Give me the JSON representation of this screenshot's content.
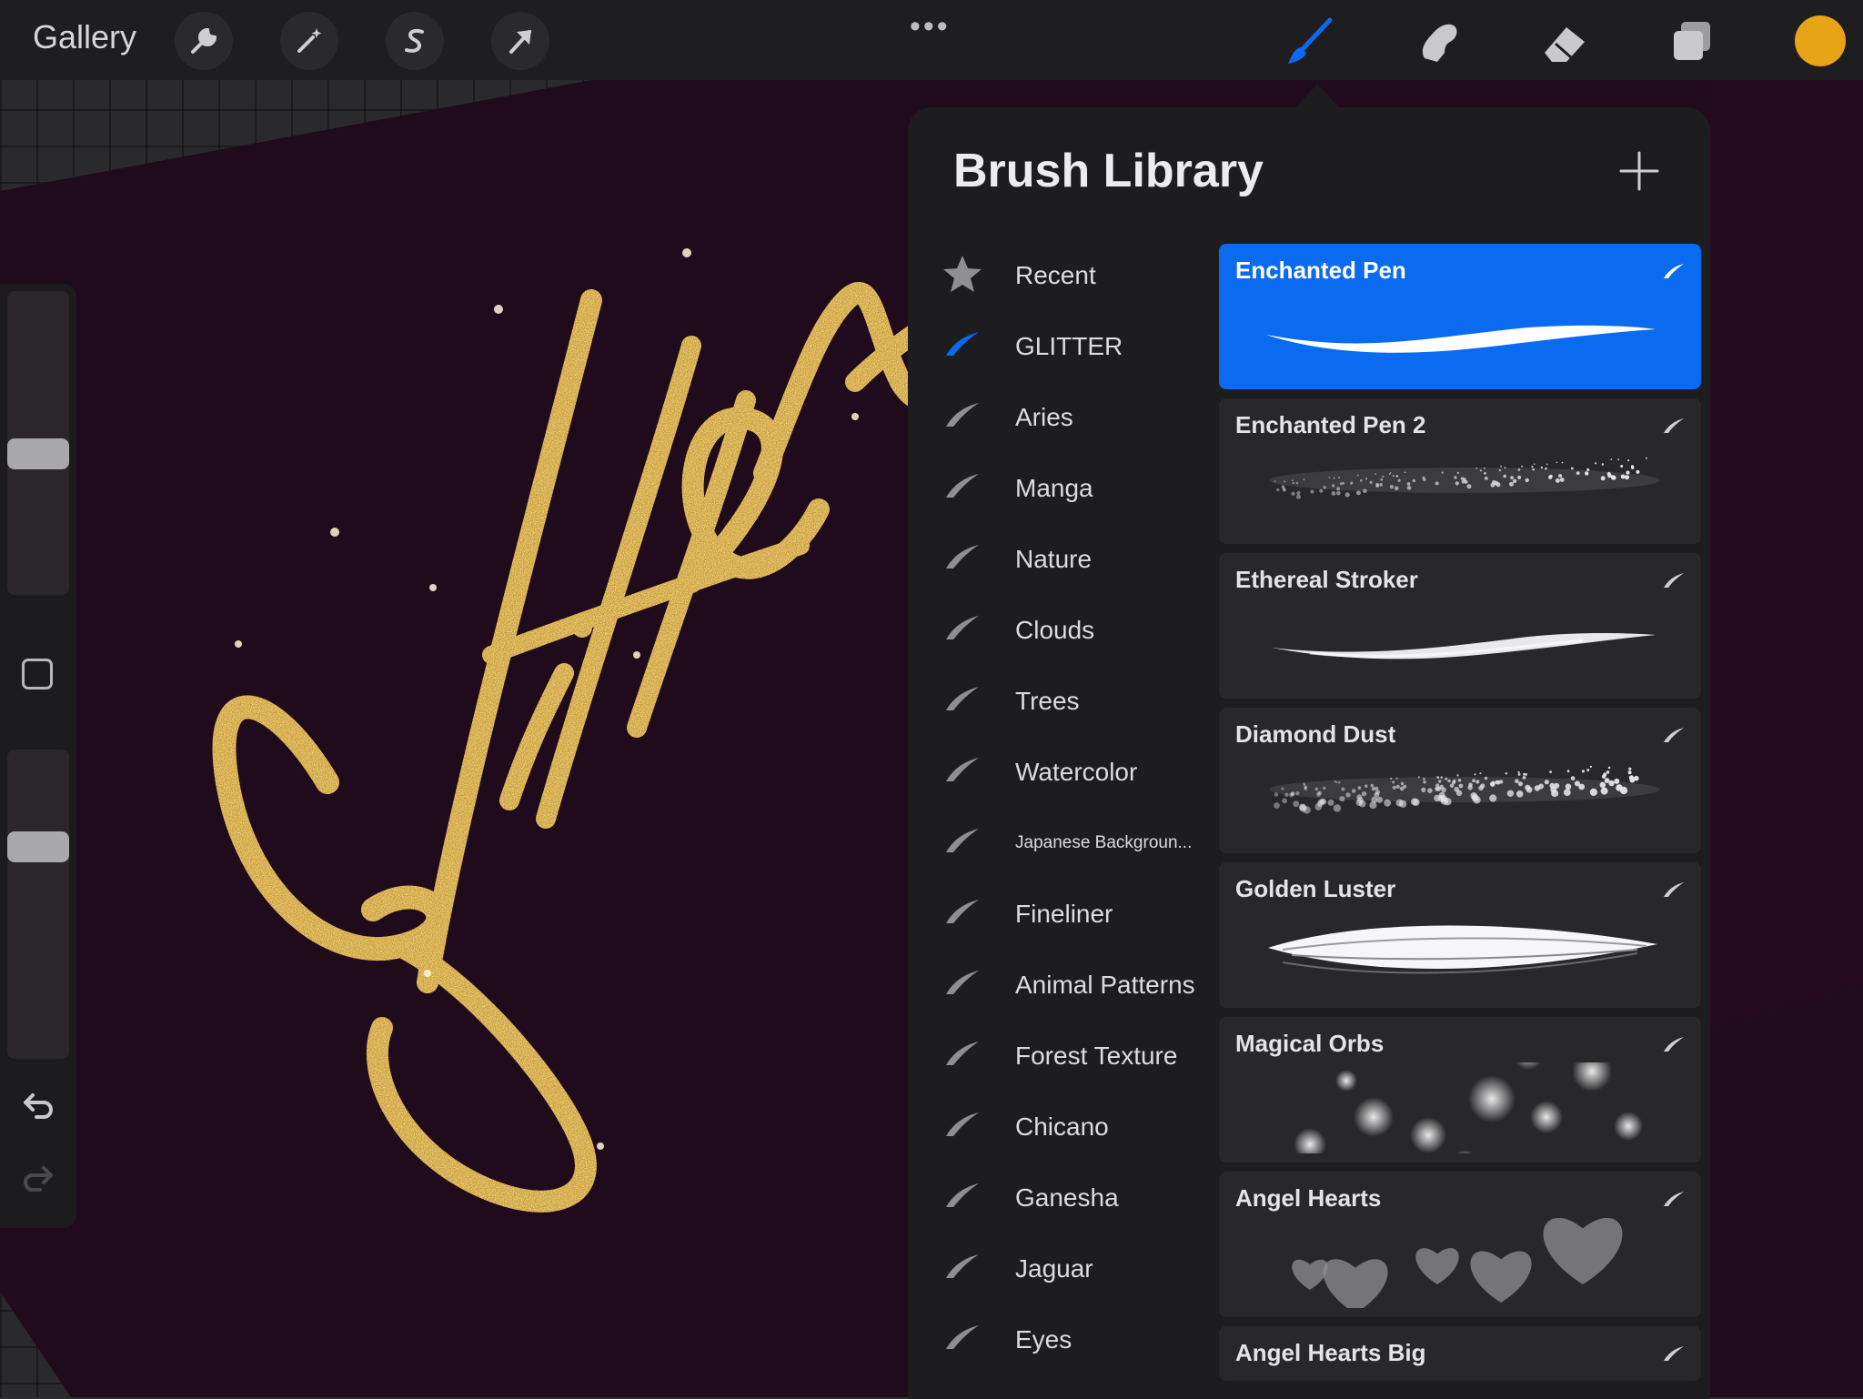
{
  "topbar": {
    "gallery_label": "Gallery",
    "more": "•••",
    "tools_left": [
      "wrench-icon",
      "magic-wand-icon",
      "selection-s-icon",
      "transform-arrow-icon"
    ],
    "tools_right": [
      "brush-icon",
      "smudge-icon",
      "eraser-icon",
      "layers-icon"
    ],
    "active_tool": "brush-icon",
    "current_color": "#e8a417",
    "brush_active_color": "#0a6af0"
  },
  "canvas": {
    "artwork_text": "Glitter",
    "background_color": "#200b1c",
    "ink_color": "#d4a62a"
  },
  "sidebar": {
    "brush_size_level": 0.52,
    "opacity_level": 0.3,
    "controls": [
      "modify-square-icon",
      "undo-icon",
      "redo-icon"
    ]
  },
  "brush_library": {
    "title": "Brush Library",
    "add_icon": "plus-icon",
    "categories": [
      {
        "label": "Recent",
        "icon": "star-icon"
      },
      {
        "label": "GLITTER",
        "icon": "brush-stroke-icon",
        "selected": true
      },
      {
        "label": "Aries",
        "icon": "brush-stroke-icon"
      },
      {
        "label": "Manga",
        "icon": "brush-stroke-icon"
      },
      {
        "label": "Nature",
        "icon": "brush-stroke-icon"
      },
      {
        "label": "Clouds",
        "icon": "brush-stroke-icon"
      },
      {
        "label": "Trees",
        "icon": "brush-stroke-icon"
      },
      {
        "label": "Watercolor",
        "icon": "brush-stroke-icon"
      },
      {
        "label": "Japanese Backgroun...",
        "icon": "brush-stroke-icon",
        "small": true
      },
      {
        "label": "Fineliner",
        "icon": "brush-stroke-icon"
      },
      {
        "label": "Animal Patterns",
        "icon": "brush-stroke-icon"
      },
      {
        "label": "Forest Texture",
        "icon": "brush-stroke-icon"
      },
      {
        "label": "Chicano",
        "icon": "brush-stroke-icon"
      },
      {
        "label": "Ganesha",
        "icon": "brush-stroke-icon"
      },
      {
        "label": "Jaguar",
        "icon": "brush-stroke-icon"
      },
      {
        "label": "Eyes",
        "icon": "brush-stroke-icon"
      }
    ],
    "brushes": [
      {
        "name": "Enchanted Pen",
        "selected": true,
        "preview": "smooth"
      },
      {
        "name": "Enchanted Pen 2",
        "preview": "sparkle"
      },
      {
        "name": "Ethereal Stroker",
        "preview": "ethereal"
      },
      {
        "name": "Diamond Dust",
        "preview": "dust"
      },
      {
        "name": "Golden Luster",
        "preview": "luster"
      },
      {
        "name": "Magical Orbs",
        "preview": "orbs"
      },
      {
        "name": "Angel Hearts",
        "preview": "hearts"
      },
      {
        "name": "Angel Hearts Big",
        "preview": "hearts-big"
      }
    ]
  }
}
